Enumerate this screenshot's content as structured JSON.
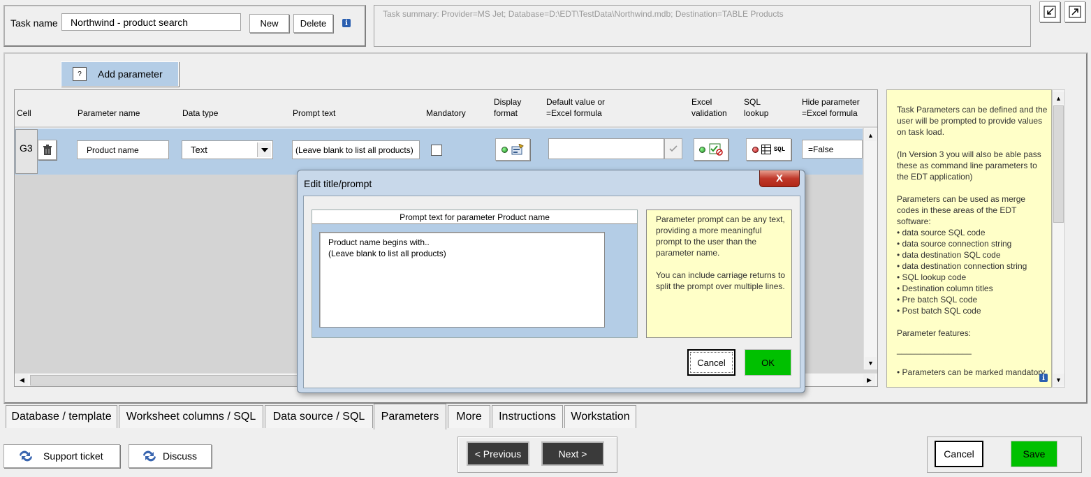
{
  "header": {
    "task_name_label": "Task name",
    "task_name_value": "Northwind - product search",
    "new_label": "New",
    "delete_label": "Delete",
    "summary": "Task summary: Provider=MS Jet; Database=D:\\EDT\\TestData\\Northwind.mdb; Destination=TABLE Products"
  },
  "params": {
    "add_label": "Add parameter",
    "columns": {
      "cell": "Cell",
      "name": "Parameter name",
      "type": "Data type",
      "prompt": "Prompt text",
      "mandatory": "Mandatory",
      "display1": "Display",
      "display2": "format",
      "default1": "Default value or",
      "default2": "=Excel formula",
      "excel1": "Excel",
      "excel2": "validation",
      "sql1": "SQL",
      "sql2": "lookup",
      "hide1": "Hide parameter",
      "hide2": "=Excel formula"
    },
    "row": {
      "cell": "G3",
      "name": "Product name",
      "type": "Text",
      "prompt": "(Leave blank to list all products)",
      "default": "",
      "hide": "=False",
      "sql_icon_text": "SQL"
    }
  },
  "help": {
    "p1": "Task Parameters can be defined and the user will be prompted to provide values on task load.",
    "p2": "(In Version 3 you will also be able pass these as command line parameters to the EDT application)",
    "p3": "Parameters can be used as merge codes in these areas of the EDT software:",
    "b1": "• data source SQL code",
    "b2": "• data source connection string",
    "b3": "• data destination SQL code",
    "b4": "• data destination connection string",
    "b5": "• SQL lookup code",
    "b6": "• Destination column titles",
    "b7": "• Pre batch SQL code",
    "b8": "• Post batch SQL code",
    "p4": "Parameter features:",
    "rule": "________________",
    "b9": "• Parameters can be marked mandatory."
  },
  "dialog": {
    "title": "Edit title/prompt",
    "close": "X",
    "header": "Prompt text for parameter Product name",
    "line1": "Product name begins with..",
    "line2": "(Leave blank to list all products)",
    "note1": "Parameter prompt can be any text, providing a more meaningful prompt to the user than the parameter name.",
    "note2": "You can include carriage returns to split the prompt over multiple lines.",
    "cancel": "Cancel",
    "ok": "OK"
  },
  "tabs": [
    "Database / template",
    "Worksheet columns / SQL",
    "Data source / SQL",
    "Parameters",
    "More",
    "Instructions",
    "Workstation"
  ],
  "footer": {
    "support": "Support ticket",
    "discuss": "Discuss",
    "previous": "< Previous",
    "next": "Next >",
    "cancel": "Cancel",
    "save": "Save"
  },
  "colors": {
    "row_blue": "#b4cde6",
    "help_yellow": "#ffffc8",
    "ok_green": "#00c000"
  }
}
